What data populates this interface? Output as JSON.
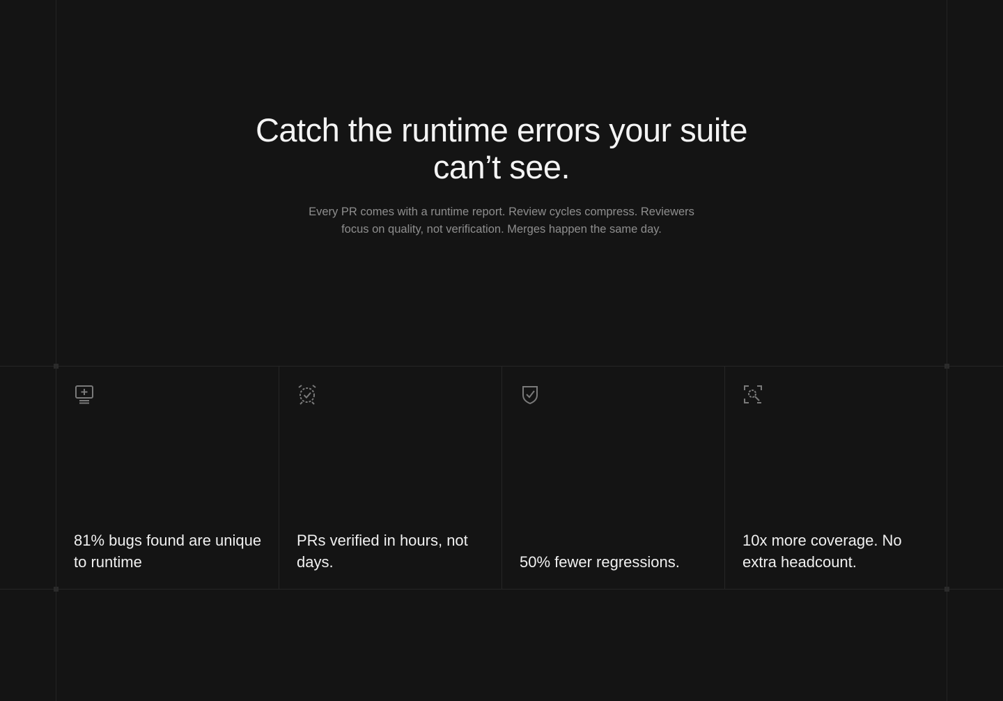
{
  "hero": {
    "title": "Catch the runtime errors your suite can’t see.",
    "subtitle": "Every PR comes with a runtime report. Review cycles compress. Reviewers focus on quality, not verification. Merges happen the same day."
  },
  "cards": [
    {
      "icon": "monitor-plus-icon",
      "text": "81% bugs found are unique to runtime"
    },
    {
      "icon": "alarm-check-icon",
      "text": "PRs verified in hours, not days."
    },
    {
      "icon": "shield-check-icon",
      "text": "50% fewer regressions."
    },
    {
      "icon": "scan-search-icon",
      "text": "10x more coverage. No extra headcount."
    }
  ],
  "colors": {
    "background": "#141414",
    "text": "#f2f2f2",
    "muted": "#8e8e8e",
    "icon": "#7a7a7a",
    "grid_line": "#262626"
  }
}
